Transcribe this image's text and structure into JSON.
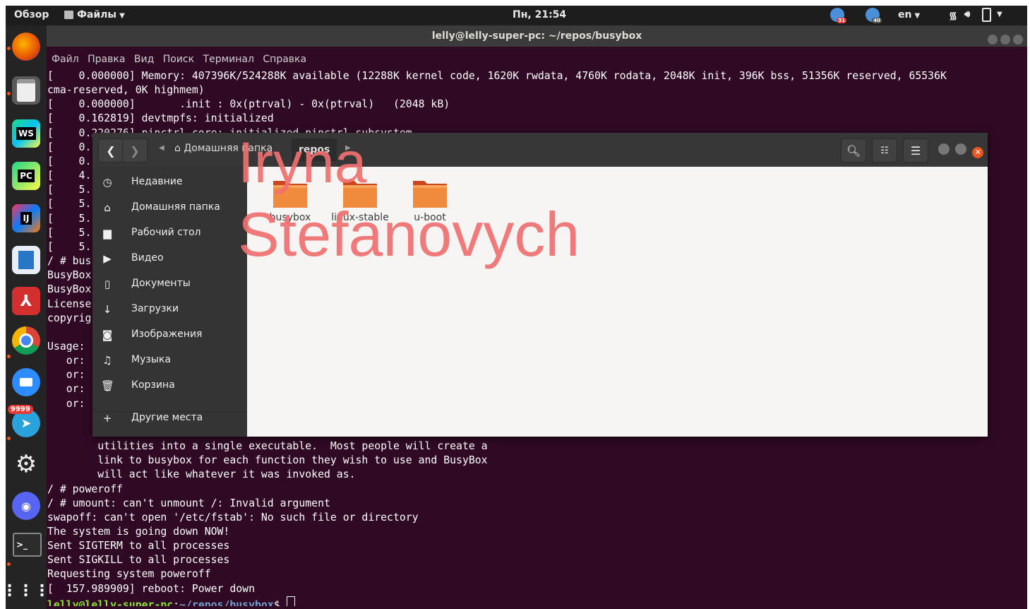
{
  "topbar": {
    "activities": "Обзор",
    "app_menu": "Файлы",
    "clock": "Пн, 21:54",
    "badge_1": "31",
    "badge_2": "40",
    "lang": "en"
  },
  "terminal": {
    "title": "lelly@lelly-super-pc: ~/repos/busybox",
    "menu": [
      "Файл",
      "Правка",
      "Вид",
      "Поиск",
      "Терминал",
      "Справка"
    ],
    "lines": [
      "[    0.000000] Memory: 407396K/524288K available (12288K kernel code, 1620K rwdata, 4760K rodata, 2048K init, 396K bss, 51356K reserved, 65536K",
      "cma-reserved, 0K highmem)",
      "[    0.000000]       .init : 0x(ptrval) - 0x(ptrval)   (2048 kB)",
      "[    0.162819] devtmpfs: initialized",
      "[    0.220276] pinctrl core: initialized pinctrl subsystem",
      "[    0.",
      "[    0.",
      "[    4.",
      "[    5.",
      "[    5.",
      "[    5.",
      "[    5.",
      "[    5.",
      "/ # bus",
      "BusyBox",
      "BusyBox",
      "License",
      "copyrig",
      "",
      "Usage:",
      "   or:",
      "   or:",
      "   or:",
      "   or:",
      "",
      "",
      "        utilities into a single executable.  Most people will create a",
      "        link to busybox for each function they wish to use and BusyBox",
      "        will act like whatever it was invoked as.",
      "/ # poweroff",
      "/ # umount: can't unmount /: Invalid argument",
      "swapoff: can't open '/etc/fstab': No such file or directory",
      "The system is going down NOW!",
      "Sent SIGTERM to all processes",
      "Sent SIGKILL to all processes",
      "Requesting system poweroff",
      "[  157.989909] reboot: Power down"
    ],
    "prompt_user": "lelly@lelly-super-pc",
    "prompt_colon": ":",
    "prompt_path": "~/repos/busybox",
    "prompt_symbol": "$ "
  },
  "dock": {
    "apps": [
      "firefox-icon",
      "files-icon",
      "webstorm-icon",
      "pycharm-icon",
      "intellij-icon",
      "libreoffice-writer-icon",
      "acrobat-icon",
      "chrome-icon",
      "zoom-icon",
      "telegram-icon",
      "settings-icon",
      "discord-icon",
      "terminal-icon",
      "show-apps-icon"
    ],
    "webstorm_label": "WS",
    "pycharm_label": "PC",
    "intellij_label": "IJ",
    "telegram_badge": "9999"
  },
  "files": {
    "breadcrumb_home": "Домашняя папка",
    "breadcrumb_current": "repos",
    "sidebar": [
      {
        "label": "Недавние",
        "icon": "clock-icon"
      },
      {
        "label": "Домашняя папка",
        "icon": "home-icon"
      },
      {
        "label": "Рабочий стол",
        "icon": "desktop-icon"
      },
      {
        "label": "Видео",
        "icon": "video-icon"
      },
      {
        "label": "Документы",
        "icon": "document-icon"
      },
      {
        "label": "Загрузки",
        "icon": "download-icon"
      },
      {
        "label": "Изображения",
        "icon": "camera-icon"
      },
      {
        "label": "Музыка",
        "icon": "music-icon"
      },
      {
        "label": "Корзина",
        "icon": "trash-icon"
      },
      {
        "label": "Другие места",
        "icon": "plus-icon"
      }
    ],
    "folders": [
      "busybox",
      "linux-stable",
      "u-boot"
    ]
  },
  "watermark": {
    "line1": "Iryna",
    "line2": "Stefanovych"
  }
}
